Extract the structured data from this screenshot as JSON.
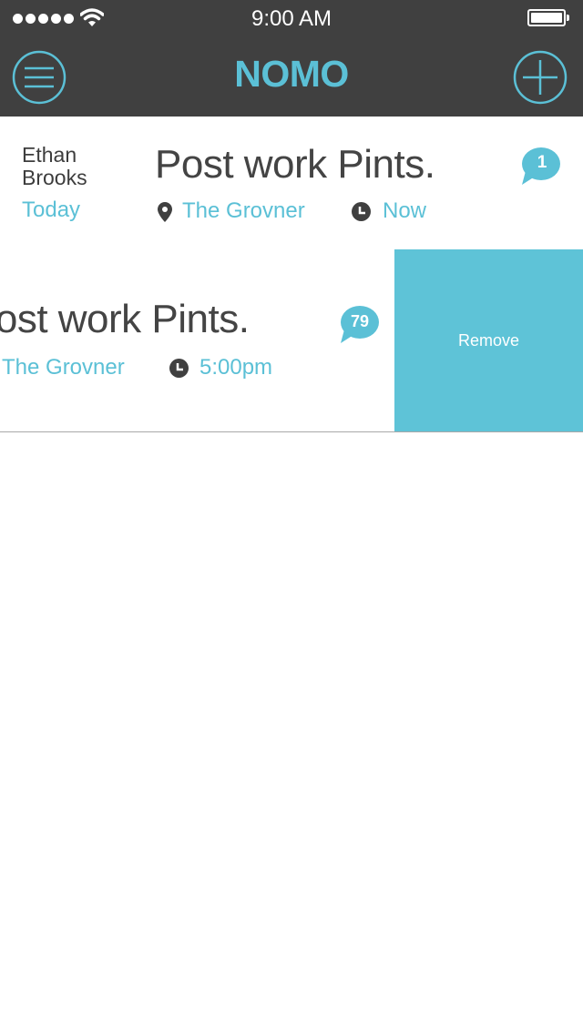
{
  "status_bar": {
    "time": "9:00 AM"
  },
  "header": {
    "title": "NOMO",
    "menu_icon": "hamburger-menu-icon",
    "add_icon": "plus-circle-icon"
  },
  "colors": {
    "accent": "#5bc0d6",
    "header_bg": "#404040",
    "text_dark": "#444444",
    "remove_bg": "#5ec3d7"
  },
  "events": [
    {
      "author": "Ethan Brooks",
      "date": "Today",
      "title": "Post work Pints.",
      "location": "The Grovner",
      "time": "Now",
      "comment_count": "1"
    },
    {
      "title": "Post work Pints.",
      "location": "The Grovner",
      "time": "5:00pm",
      "comment_count": "79",
      "swipe_action": "Remove"
    }
  ]
}
